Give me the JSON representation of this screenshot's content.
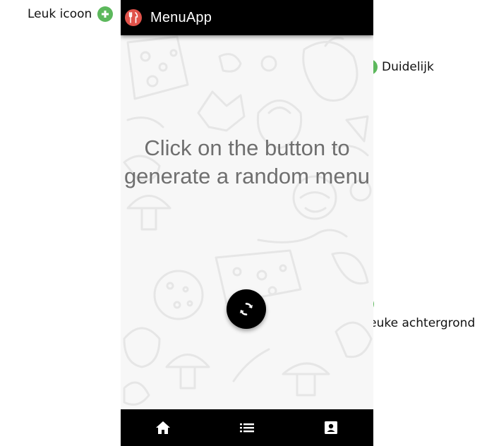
{
  "annotations": {
    "leuk_icoon": "Leuk icoon",
    "duidelijk": "Duidelijk",
    "leuke_achtergrond": "Leuke achtergrond"
  },
  "app": {
    "title": "MenuApp",
    "icon": "fork-knife-icon",
    "accent_color": "#e0524a",
    "bar_color": "#000000"
  },
  "main": {
    "prompt": "Click on the button to generate a random menu",
    "generate_button_icon": "refresh-icon",
    "background": "food-doodle-pattern"
  },
  "bottom_nav": {
    "items": [
      {
        "icon": "home-icon"
      },
      {
        "icon": "list-icon"
      },
      {
        "icon": "contact-card-icon"
      }
    ]
  }
}
